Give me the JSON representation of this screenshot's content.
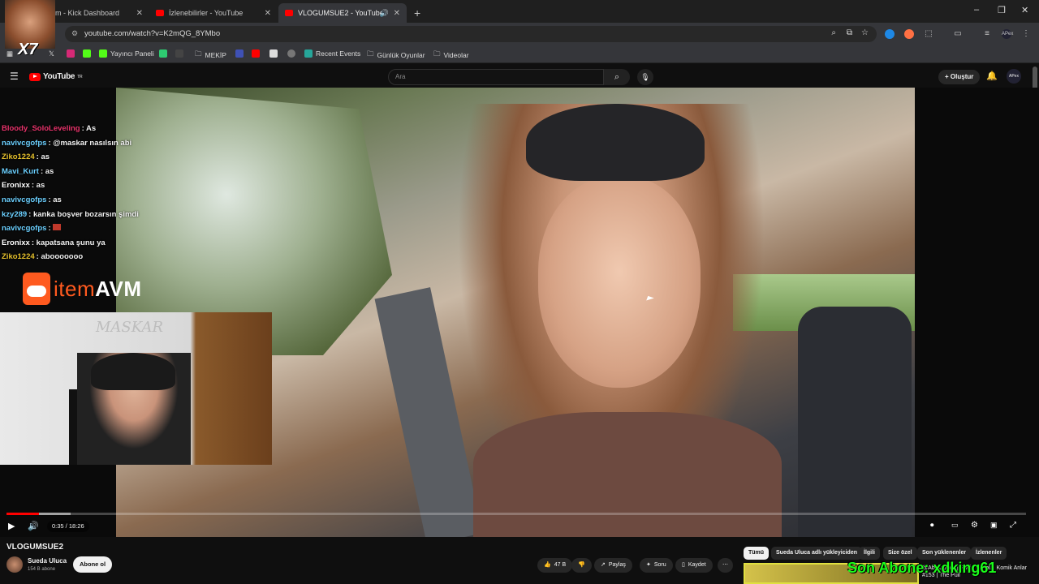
{
  "browser": {
    "tabs": [
      {
        "label": "m - Kick Dashboard"
      },
      {
        "label": "İzlenebilirler - YouTube"
      },
      {
        "label": "VLOGUMSUE2 - YouTube"
      }
    ],
    "new_tab": "+",
    "url": "youtube.com/watch?v=K2mQG_8YMbo",
    "bookmarks": [
      {
        "label": "Yayıncı Paneli"
      },
      {
        "label": "MEKİP"
      },
      {
        "label": "Recent Events"
      },
      {
        "label": "Günlük Oyunlar"
      },
      {
        "label": "Videolar"
      }
    ],
    "window_controls": {
      "minimize": "–",
      "restore": "❐",
      "close": "✕"
    }
  },
  "youtube": {
    "logo": "YouTube",
    "logo_suffix": "TR",
    "search_placeholder": "Ara",
    "create_label": "Oluştur",
    "profile": "APex"
  },
  "chat": [
    {
      "user": "Bloody_SoloLeveling",
      "text": ": As",
      "color": "#e8336b"
    },
    {
      "user": "navivcgofps",
      "text": ": @maskar nasılsın abi",
      "color": "#6bd0ff"
    },
    {
      "user": "Ziko1224",
      "text": ": as",
      "color": "#e6c12c"
    },
    {
      "user": "Mavi_Kurt",
      "text": ": as",
      "color": "#6bd0ff"
    },
    {
      "user": "Eronixx",
      "text": ": as",
      "color": "#ffffff"
    },
    {
      "user": "navivcgofps",
      "text": ": as",
      "color": "#6bd0ff"
    },
    {
      "user": "kzy289",
      "text": ": kanka boşver bozarsın şimdi",
      "color": "#6bd0ff"
    },
    {
      "user": "navivcgofps",
      "text": ":",
      "color": "#6bd0ff"
    },
    {
      "user": "Eronixx",
      "text": ": kapatsana şunu ya",
      "color": "#ffffff"
    },
    {
      "user": "Ziko1224",
      "text": ": abooooooo",
      "color": "#e6c12c"
    }
  ],
  "sponsor": {
    "brand_a": "item",
    "brand_b": "AVM"
  },
  "webcam_wall_text": "MASKAR",
  "emote_label": "X7",
  "player": {
    "time": "0:35 / 18:26",
    "progress": 0.032,
    "buffered": 0.063
  },
  "video": {
    "title": "VLOGUMSUE2",
    "channel": "Sueda Uluca",
    "subscribers": "154 B abone",
    "subscribe_label": "Abone ol",
    "likes": "47 B",
    "share_label": "Paylaş",
    "ask_label": "Soru",
    "save_label": "Kaydet"
  },
  "chips": [
    {
      "label": "Tümü",
      "active": true
    },
    {
      "label": "Sueda Uluca adlı yükleyiciden"
    },
    {
      "label": "İlgili"
    },
    {
      "label": "Size özel"
    },
    {
      "label": "Son yüklenenler"
    },
    {
      "label": "İzlenenler"
    }
  ],
  "overlay": {
    "last_sub": "Son Abone: xdking61"
  },
  "recommended_title": "@Abologram | Rollin' & Fal... Komik Anlar #153 | The Pull"
}
